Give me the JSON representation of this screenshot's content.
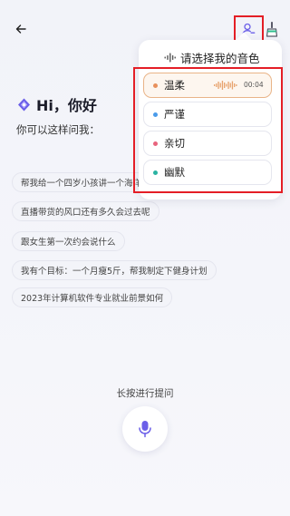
{
  "topbar": {
    "back_icon": "arrow-left-icon",
    "voice_icon": "user-voice-icon",
    "clean_icon": "broom-icon"
  },
  "greeting": {
    "title": "Hi，你好",
    "subtitle": "你可以这样问我："
  },
  "suggestions": [
    "帮我给一个四岁小孩讲一个海洋生物",
    "直播带货的风口还有多久会过去呢",
    "跟女生第一次约会说什么",
    "我有个目标：一个月瘦5斤，帮我制定下健身计划",
    "2023年计算机软件专业就业前景如何"
  ],
  "voice_panel": {
    "title": "请选择我的音色",
    "items": [
      {
        "name": "温柔",
        "dot_color": "#e8905c",
        "selected": true,
        "duration": "00:04"
      },
      {
        "name": "严谨",
        "dot_color": "#4a9bea",
        "selected": false
      },
      {
        "name": "亲切",
        "dot_color": "#e8647d",
        "selected": false
      },
      {
        "name": "幽默",
        "dot_color": "#2ab3a2",
        "selected": false
      }
    ]
  },
  "footer": {
    "hint": "长按进行提问",
    "mic_icon": "microphone-icon"
  },
  "colors": {
    "accent": "#6a5ee8",
    "highlight": "#e41e26",
    "selected_bg": "#fdf6ef"
  }
}
